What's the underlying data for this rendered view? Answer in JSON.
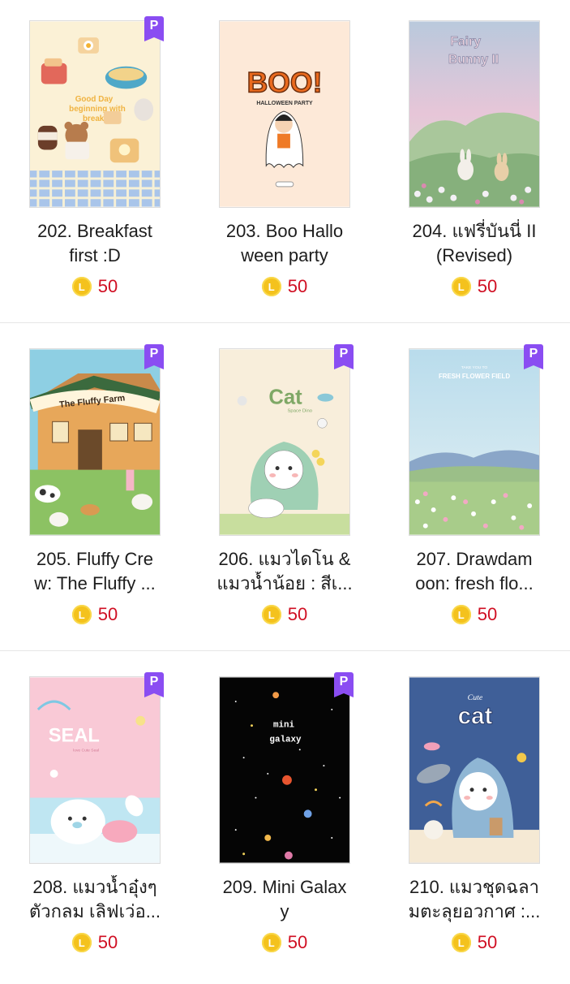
{
  "badge_label": "P",
  "coin_label": "L",
  "colors": {
    "badge": "#8a4df2",
    "coin": "#f4c21d",
    "price": "#d00f23"
  },
  "rows": [
    [
      {
        "title_lines": [
          "202. Breakfast",
          "first :D"
        ],
        "price": "50",
        "premium": true
      },
      {
        "title_lines": [
          "203. Boo Hallo",
          "ween party"
        ],
        "price": "50",
        "premium": false
      },
      {
        "title_lines": [
          "204. แฟรี่บันนี่ II",
          "(Revised)"
        ],
        "price": "50",
        "premium": false
      }
    ],
    [
      {
        "title_lines": [
          "205. Fluffy Cre",
          "w: The Fluffy ..."
        ],
        "price": "50",
        "premium": true
      },
      {
        "title_lines": [
          "206. แมวไดโน &",
          "แมวน้ำน้อย : สีเ..."
        ],
        "price": "50",
        "premium": true
      },
      {
        "title_lines": [
          "207. Drawdam",
          "oon: fresh flo..."
        ],
        "price": "50",
        "premium": true
      }
    ],
    [
      {
        "title_lines": [
          "208. แมวน้ำอุ๋งๆ",
          "ตัวกลม เลิฟเว่อ..."
        ],
        "price": "50",
        "premium": true
      },
      {
        "title_lines": [
          "209. Mini Galax",
          "y"
        ],
        "price": "50",
        "premium": true
      },
      {
        "title_lines": [
          "210. แมวชุดฉลา",
          "มตะลุยอวกาศ :..."
        ],
        "price": "50",
        "premium": false
      }
    ]
  ],
  "thumbnails": {
    "t202": {
      "text_a": "Good Day",
      "text_b": "beginning with",
      "text_c": "breakfast"
    },
    "t203": {
      "text_a": "BOO!",
      "text_b": "HALLOWEEN PARTY"
    },
    "t204": {
      "text_a": "Fairy",
      "text_b": "Bunny II"
    },
    "t205": {
      "text_a": "The Fluffy Farm"
    },
    "t206": {
      "text_a": "Cat",
      "text_b": "Space Dino"
    },
    "t207": {
      "text_a": "TAKE YOU TO",
      "text_b": "FRESH FLOWER FIELD"
    },
    "t208": {
      "text_a": "SEAL",
      "text_b": "love Cute Seal"
    },
    "t209": {
      "text_a": "mini",
      "text_b": "galaxy"
    },
    "t210": {
      "text_a": "Cute",
      "text_b": "cat"
    }
  }
}
